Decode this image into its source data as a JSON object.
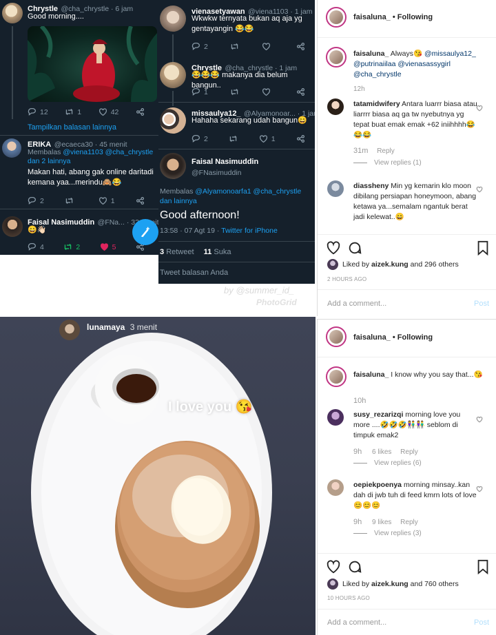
{
  "tweets_left": {
    "t1": {
      "name": "Chrystle",
      "handle": "@cha_chrystle · 6 jam",
      "text": "Good morning....",
      "replies": "12",
      "retweets": "1",
      "likes": "42"
    },
    "show_more": "Tampilkan balasan lainnya",
    "t2": {
      "name": "ERIKA",
      "handle": "@ecaeca30 · 45 menit",
      "reply_prefix": "Membalas",
      "reply_to": "@viena1103 @cha_chrystle dan 2 lainnya",
      "text": "Makan hati, abang gak online daritadi kemana yaa...merindu🙈😂",
      "replies": "2",
      "retweets": "",
      "likes": "1"
    },
    "t3": {
      "name": "Faisal Nasimuddin",
      "handle": "@FNa... · 32 menit",
      "text": "😄👋🏻",
      "replies": "4",
      "retweets": "2",
      "likes": "5"
    }
  },
  "tweets_right": {
    "t1": {
      "name": "vienasetyawan",
      "handle": "@viena1103 · 1 jam",
      "text": "Wkwkw ternyata bukan aq aja yg gentayangin 😂😂",
      "replies": "2",
      "likes": ""
    },
    "t2": {
      "name": "Chrystle",
      "handle": "@cha_chrystle · 1 jam",
      "text": "😂😂😂 makanya dia belum bangun..",
      "replies": "1",
      "likes": ""
    },
    "t3": {
      "name": "missaulya12_",
      "handle": "@Alyamonoar... · 1 jam",
      "text": "Hahaha sekarang udah bangun😄",
      "replies": "2",
      "likes": "1"
    },
    "main": {
      "name": "Faisal Nasimuddin",
      "handle": "@FNasimuddin",
      "reply_prefix": "Membalas",
      "reply_to": "@Alyamonoarfa1 @cha_chrystle dan lainnya",
      "text": "Good afternoon!",
      "time": "13:58 · 07 Agt 19 · ",
      "client": "Twitter for iPhone",
      "retweet_count": "3",
      "retweet_label": "Retweet",
      "like_count": "11",
      "like_label": "Suka",
      "reply_placeholder": "Tweet balasan Anda"
    },
    "watermark1": "by @summer_id_",
    "watermark2": "PhotoGrid"
  },
  "story": {
    "username": "lunamaya",
    "time": "3 menit",
    "sticker_text": "I love you 😘"
  },
  "ig_post1": {
    "username": "faisaluna_",
    "follow_status": "• Following",
    "caption_user": "faisaluna_",
    "caption_text": "Always😘 ",
    "caption_tags": "@missaulya12_ @putrinaiilaa @vienasassygirl @cha_chrystle",
    "caption_time": "12h",
    "c1": {
      "user": "tatamidwifery",
      "text": "Antara luarrr biasa atau liarrrr biasa aq ga tw nyebutnya yg tepat buat emak emak +62 iniihhhh😂😂😂",
      "time": "31m",
      "reply": "Reply",
      "view": "View replies (1)"
    },
    "c2": {
      "user": "diassheny",
      "text": "Min yg kemarin klo moon dibilang persiapan honeymoon, abang ketawa ya...semalam ngantuk berat jadi kelewat..😄"
    },
    "liked_prefix": "Liked by",
    "liked_user": "aizek.kung",
    "liked_suffix": "and 296 others",
    "post_time": "2 HOURS AGO",
    "add_comment": "Add a comment...",
    "post_label": "Post"
  },
  "ig_post2": {
    "username": "faisaluna_",
    "follow_status": "• Following",
    "caption_user": "faisaluna_",
    "caption_text": "I know why you say that...😘",
    "caption_time": "10h",
    "c1": {
      "user": "susy_rezarizqi",
      "text": "morning love you more ....🤣🤣🤣👫👫 seblom di timpuk emak2",
      "time": "9h",
      "likes": "6 likes",
      "reply": "Reply",
      "view": "View replies (6)"
    },
    "c2": {
      "user": "oepiekpoenya",
      "text": "morning minsay..kan dah di jwb tuh di feed kmrn lots of love 😊😊😊",
      "time": "9h",
      "likes": "9 likes",
      "reply": "Reply",
      "view": "View replies (3)"
    },
    "liked_prefix": "Liked by",
    "liked_user": "aizek.kung",
    "liked_suffix": "and 760 others",
    "post_time": "10 HOURS AGO",
    "add_comment": "Add a comment...",
    "post_label": "Post"
  },
  "colors": {
    "twitter_bg": "#15202b",
    "twitter_blue": "#1da1f2",
    "ig_link": "#003569",
    "like_red": "#e0245e",
    "rt_green": "#17bf63"
  }
}
